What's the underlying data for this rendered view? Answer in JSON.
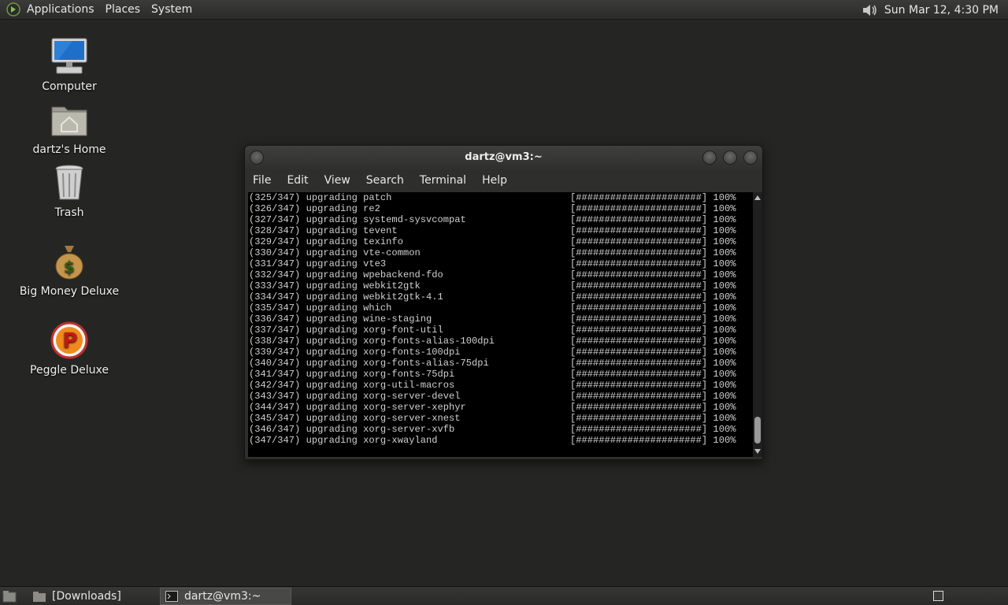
{
  "top_panel": {
    "menus": [
      "Applications",
      "Places",
      "System"
    ],
    "clock": "Sun Mar 12,  4:30 PM"
  },
  "desktop_icons": [
    {
      "label": "Computer",
      "icon": "computer-icon"
    },
    {
      "label": "dartz's Home",
      "icon": "home-folder-icon"
    },
    {
      "label": "Trash",
      "icon": "trash-icon"
    },
    {
      "label": "Big Money Deluxe",
      "icon": "money-bag-icon"
    },
    {
      "label": "Peggle Deluxe",
      "icon": "peggle-icon"
    }
  ],
  "terminal": {
    "title": "dartz@vm3:~",
    "menu": [
      "File",
      "Edit",
      "View",
      "Search",
      "Terminal",
      "Help"
    ],
    "lines": [
      {
        "left": "(325/347) upgrading patch",
        "right": "[######################] 100%"
      },
      {
        "left": "(326/347) upgrading re2",
        "right": "[######################] 100%"
      },
      {
        "left": "(327/347) upgrading systemd-sysvcompat",
        "right": "[######################] 100%"
      },
      {
        "left": "(328/347) upgrading tevent",
        "right": "[######################] 100%"
      },
      {
        "left": "(329/347) upgrading texinfo",
        "right": "[######################] 100%"
      },
      {
        "left": "(330/347) upgrading vte-common",
        "right": "[######################] 100%"
      },
      {
        "left": "(331/347) upgrading vte3",
        "right": "[######################] 100%"
      },
      {
        "left": "(332/347) upgrading wpebackend-fdo",
        "right": "[######################] 100%"
      },
      {
        "left": "(333/347) upgrading webkit2gtk",
        "right": "[######################] 100%"
      },
      {
        "left": "(334/347) upgrading webkit2gtk-4.1",
        "right": "[######################] 100%"
      },
      {
        "left": "(335/347) upgrading which",
        "right": "[######################] 100%"
      },
      {
        "left": "(336/347) upgrading wine-staging",
        "right": "[######################] 100%"
      },
      {
        "left": "(337/347) upgrading xorg-font-util",
        "right": "[######################] 100%"
      },
      {
        "left": "(338/347) upgrading xorg-fonts-alias-100dpi",
        "right": "[######################] 100%"
      },
      {
        "left": "(339/347) upgrading xorg-fonts-100dpi",
        "right": "[######################] 100%"
      },
      {
        "left": "(340/347) upgrading xorg-fonts-alias-75dpi",
        "right": "[######################] 100%"
      },
      {
        "left": "(341/347) upgrading xorg-fonts-75dpi",
        "right": "[######################] 100%"
      },
      {
        "left": "(342/347) upgrading xorg-util-macros",
        "right": "[######################] 100%"
      },
      {
        "left": "(343/347) upgrading xorg-server-devel",
        "right": "[######################] 100%"
      },
      {
        "left": "(344/347) upgrading xorg-server-xephyr",
        "right": "[######################] 100%"
      },
      {
        "left": "(345/347) upgrading xorg-server-xnest",
        "right": "[######################] 100%"
      },
      {
        "left": "(346/347) upgrading xorg-server-xvfb",
        "right": "[######################] 100%"
      },
      {
        "left": "(347/347) upgrading xorg-xwayland",
        "right": "[######################] 100%"
      }
    ]
  },
  "taskbar": {
    "tasks": [
      {
        "label": "[Downloads]",
        "icon": "folder-icon",
        "active": false
      },
      {
        "label": "dartz@vm3:~",
        "icon": "terminal-icon",
        "active": true
      }
    ]
  },
  "colors": {
    "desktop_bg": "#252624",
    "terminal_bg": "#000000",
    "terminal_fg": "#d0d0d0"
  }
}
